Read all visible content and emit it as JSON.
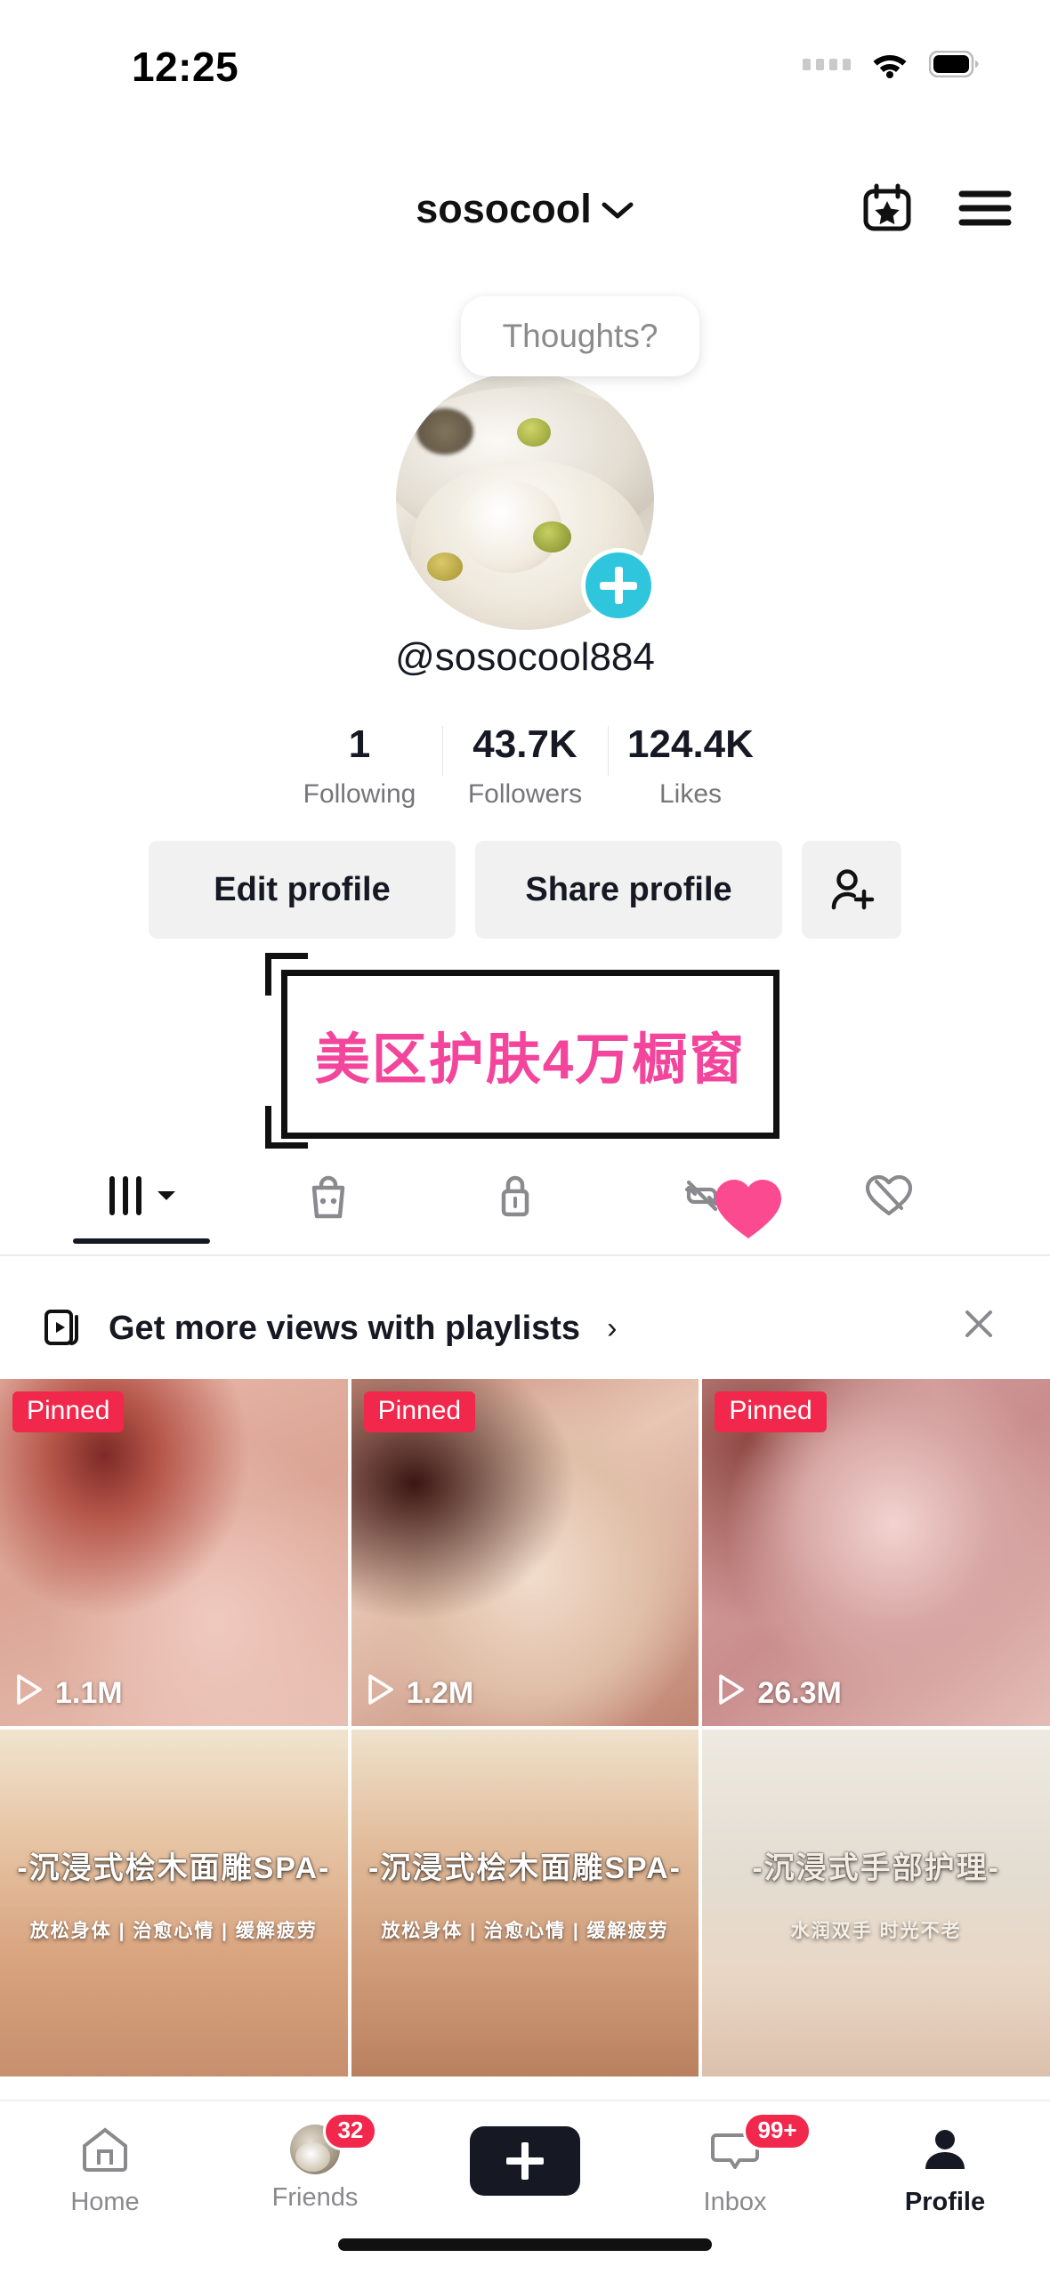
{
  "status_bar": {
    "time": "12:25",
    "cellular_icon": "signal-dots-icon",
    "wifi_icon": "wifi-icon",
    "battery_icon": "battery-icon"
  },
  "header": {
    "title": "sosocool",
    "title_caret_icon": "chevron-down-icon",
    "studio_icon": "calendar-star-icon",
    "menu_icon": "hamburger-menu-icon"
  },
  "profile": {
    "thought_bubble": "Thoughts?",
    "avatar_name": "profile-avatar",
    "add_story_icon": "plus-icon",
    "handle": "@sosocool884",
    "stats": [
      {
        "value": "1",
        "label": "Following"
      },
      {
        "value": "43.7K",
        "label": "Followers"
      },
      {
        "value": "124.4K",
        "label": "Likes"
      }
    ],
    "edit_profile_label": "Edit profile",
    "share_profile_label": "Share profile",
    "add_friends_icon": "add-person-icon",
    "bio_sticker_text": "美区护肤4万橱窗",
    "bio_sticker_color": "#f2459b",
    "heart_sticker_icon": "heart-icon"
  },
  "tabs": [
    {
      "name": "videos",
      "icon": "grid-icon",
      "caret": "caret-down-icon",
      "active": true
    },
    {
      "name": "shop",
      "icon": "shopping-bag-icon",
      "active": false
    },
    {
      "name": "private",
      "icon": "lock-icon",
      "active": false
    },
    {
      "name": "reposts",
      "icon": "repost-hidden-icon",
      "active": false
    },
    {
      "name": "liked",
      "icon": "heart-hidden-icon",
      "active": false
    }
  ],
  "banner": {
    "icon": "playlist-icon",
    "text": "Get more views with playlists",
    "chevron": "›",
    "close_icon": "close-icon"
  },
  "videos": [
    {
      "pinned_label": "Pinned",
      "views": "1.1M",
      "play_icon": "play-icon",
      "overlay_main": "",
      "overlay_sub": ""
    },
    {
      "pinned_label": "Pinned",
      "views": "1.2M",
      "play_icon": "play-icon",
      "overlay_main": "",
      "overlay_sub": ""
    },
    {
      "pinned_label": "Pinned",
      "views": "26.3M",
      "play_icon": "play-icon",
      "overlay_main": "",
      "overlay_sub": ""
    },
    {
      "pinned_label": "",
      "views": "",
      "play_icon": "",
      "overlay_main": "-沉浸式桧木面雕SPA-",
      "overlay_sub": "放松身体 | 治愈心情 | 缓解疲劳"
    },
    {
      "pinned_label": "",
      "views": "",
      "play_icon": "",
      "overlay_main": "-沉浸式桧木面雕SPA-",
      "overlay_sub": "放松身体 | 治愈心情 | 缓解疲劳"
    },
    {
      "pinned_label": "",
      "views": "",
      "play_icon": "",
      "overlay_main": "-沉浸式手部护理-",
      "overlay_sub": "水润双手    时光不老"
    }
  ],
  "bottom_nav": [
    {
      "label": "Home",
      "icon": "home-icon",
      "badge": "",
      "active": false
    },
    {
      "label": "Friends",
      "icon": "friends-avatar-icon",
      "badge": "32",
      "active": false
    },
    {
      "label": "",
      "icon": "create-plus-icon",
      "badge": "",
      "active": false
    },
    {
      "label": "Inbox",
      "icon": "inbox-icon",
      "badge": "99+",
      "active": false
    },
    {
      "label": "Profile",
      "icon": "person-icon",
      "badge": "",
      "active": true
    }
  ],
  "colors": {
    "accent_pink": "#fe2c55",
    "accent_cyan": "#25f4ee",
    "badge_red": "#f2274c",
    "story_plus": "#2ec5dd"
  }
}
